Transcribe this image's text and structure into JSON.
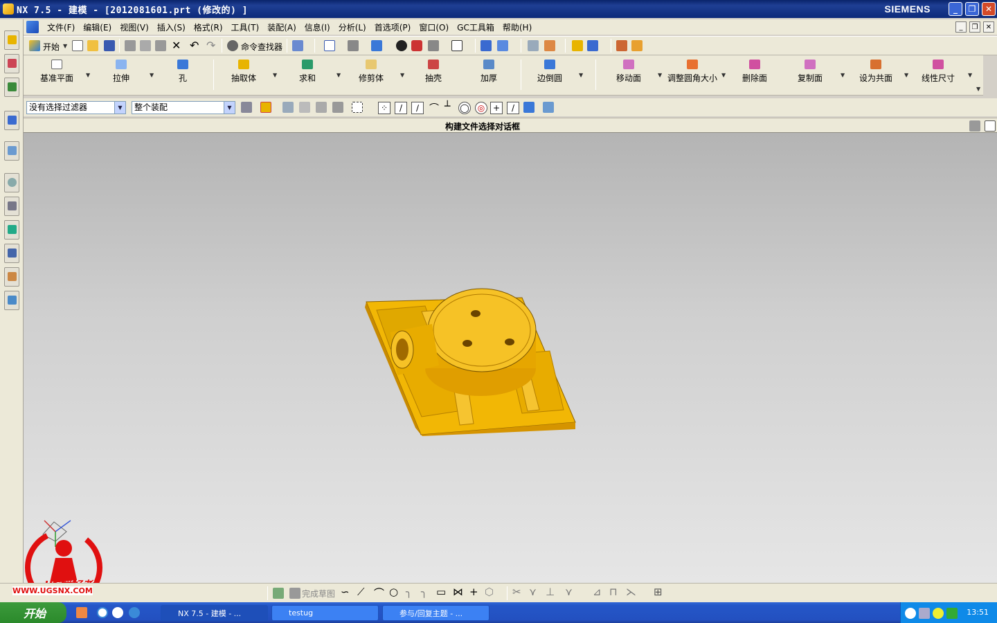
{
  "window": {
    "title": "NX 7.5 - 建模 - [2012081601.prt  (修改的) ]",
    "brand": "SIEMENS",
    "controls": [
      "_",
      "❐",
      "✕"
    ]
  },
  "menubar": {
    "items": [
      "文件(F)",
      "编辑(E)",
      "视图(V)",
      "插入(S)",
      "格式(R)",
      "工具(T)",
      "装配(A)",
      "信息(I)",
      "分析(L)",
      "首选项(P)",
      "窗口(O)",
      "GC工具箱",
      "帮助(H)"
    ]
  },
  "standard_toolbar": {
    "start_label": "开始",
    "command_finder_label": "命令查找器"
  },
  "feature_toolbar": {
    "buttons": [
      "基准平面",
      "拉伸",
      "孔",
      "抽取体",
      "求和",
      "修剪体",
      "抽壳",
      "加厚",
      "边倒圆",
      "移动面",
      "调整圆角大小",
      "删除面",
      "复制面",
      "设为共面",
      "线性尺寸"
    ]
  },
  "selection_bar": {
    "filter_value": "没有选择过滤器",
    "scope_value": "整个装配"
  },
  "cue_line": "构建文件选择对话框",
  "sketch_toolbar": {
    "finish_sketch_label": "完成草图"
  },
  "watermark": {
    "text": "UG爱好者",
    "url": "WWW.UGSNX.COM"
  },
  "taskbar": {
    "start_label": "开始",
    "tasks": [
      "NX 7.5 - 建模 - ...",
      "testug",
      "参与/回复主题 - ..."
    ],
    "clock": "13:51"
  },
  "colors": {
    "part": "#f2b705",
    "part_shadow": "#c88a00",
    "titlebar": "#0a246a",
    "taskbar": "#2457c8"
  }
}
